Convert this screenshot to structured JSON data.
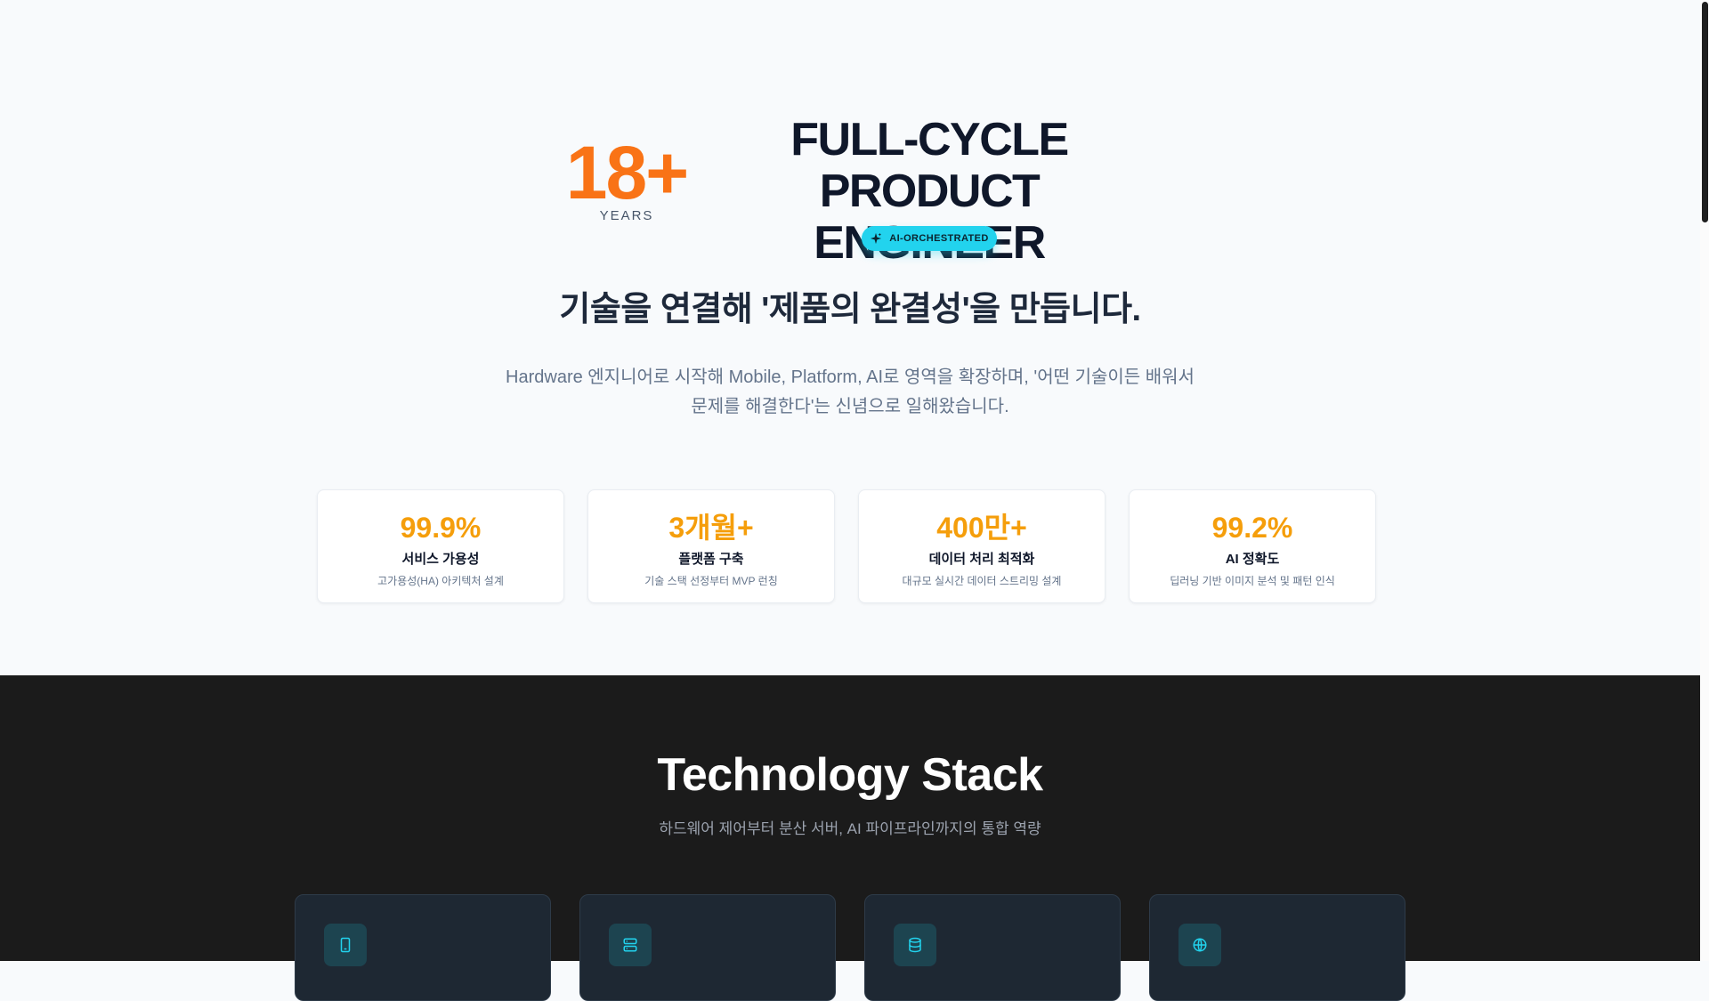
{
  "hero": {
    "years_number": "18+",
    "years_label": "YEARS",
    "title_line1": "FULL-CYCLE",
    "title_line2": "PRODUCT ENGINEER",
    "badge": {
      "label": "AI-ORCHESTRATED",
      "icon": "sparkle-icon"
    },
    "headline": "기술을 연결해 '제품의 완결성'을 만듭니다.",
    "intro": "Hardware 엔지니어로 시작해 Mobile, Platform, AI로 영역을 확장하며, '어떤 기술이든 배워서 문제를 해결한다'는 신념으로 일해왔습니다."
  },
  "stats": [
    {
      "value": "99.9%",
      "title": "서비스 가용성",
      "desc": "고가용성(HA) 아키텍처 설계"
    },
    {
      "value": "3개월+",
      "title": "플랫폼 구축",
      "desc": "기술 스택 선정부터 MVP 런칭"
    },
    {
      "value": "400만+",
      "title": "데이터 처리 최적화",
      "desc": "대규모 실시간 데이터 스트리밍 설계"
    },
    {
      "value": "99.2%",
      "title": "AI 정확도",
      "desc": "딥러닝 기반 이미지 분석 및 패턴 인식"
    }
  ],
  "tech": {
    "title": "Technology Stack",
    "subtitle": "하드웨어 제어부터 분산 서버, AI 파이프라인까지의 통합 역량",
    "cards": [
      {
        "icon": "smartphone-icon"
      },
      {
        "icon": "server-icon"
      },
      {
        "icon": "database-icon"
      },
      {
        "icon": "globe-icon"
      }
    ]
  },
  "colors": {
    "accent_orange": "#f97316",
    "stat_value": "#f59e0b",
    "badge_cyan": "#22d3ee",
    "dark_section": "#1b1b1b",
    "icon_cyan": "#22d3ee"
  }
}
